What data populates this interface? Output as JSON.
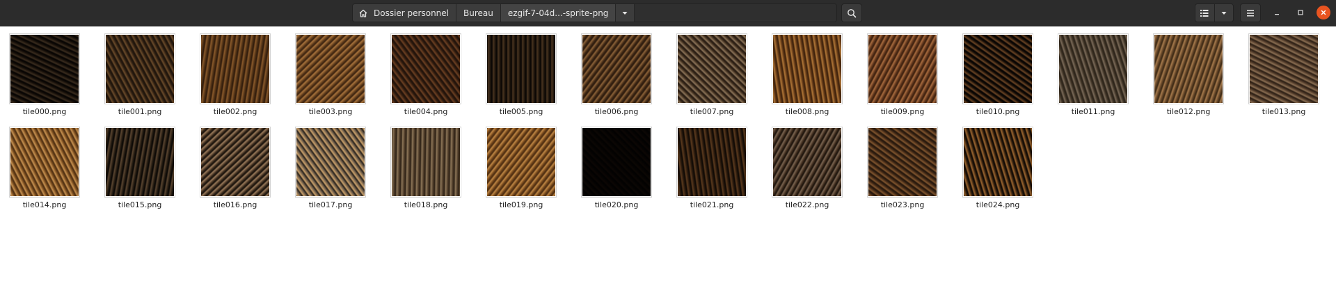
{
  "header": {
    "breadcrumbs": [
      {
        "label": "Dossier personnel",
        "icon": "home-icon"
      },
      {
        "label": "Bureau"
      },
      {
        "label": "ezgif-7-04d...-sprite-png"
      }
    ],
    "search_icon": "search-icon",
    "view_icon": "list-view-icon",
    "view_options_icon": "chevron-down-icon",
    "menu_icon": "hamburger-menu-icon",
    "window_controls": [
      "minimize-icon",
      "maximize-icon",
      "close-icon"
    ],
    "accent_close": "#e95420"
  },
  "files": [
    {
      "name": "tile000.png",
      "colors": [
        "#050302",
        "#3a2c1e",
        "#120c07"
      ]
    },
    {
      "name": "tile001.png",
      "colors": [
        "#1c130b",
        "#6b4b2a",
        "#2a1c10"
      ]
    },
    {
      "name": "tile002.png",
      "colors": [
        "#2e1a0b",
        "#8a5a2b",
        "#4b2e14"
      ]
    },
    {
      "name": "tile003.png",
      "colors": [
        "#3a220f",
        "#a8733c",
        "#5d3a1a"
      ]
    },
    {
      "name": "tile004.png",
      "colors": [
        "#1e110a",
        "#6d4022",
        "#2d1a0e"
      ]
    },
    {
      "name": "tile005.png",
      "colors": [
        "#060403",
        "#4a3520",
        "#1c130b"
      ]
    },
    {
      "name": "tile006.png",
      "colors": [
        "#2b1a0d",
        "#8c6238",
        "#3e2714"
      ]
    },
    {
      "name": "tile007.png",
      "colors": [
        "#231810",
        "#8b7358",
        "#3d2c1c"
      ]
    },
    {
      "name": "tile008.png",
      "colors": [
        "#3a1f0a",
        "#b07637",
        "#5a3314"
      ]
    },
    {
      "name": "tile009.png",
      "colors": [
        "#3b1f0d",
        "#a86b3e",
        "#5a321a"
      ]
    },
    {
      "name": "tile010.png",
      "colors": [
        "#030202",
        "#6a4424",
        "#140c06"
      ]
    },
    {
      "name": "tile011.png",
      "colors": [
        "#2a2218",
        "#7a6a58",
        "#3a2f22"
      ]
    },
    {
      "name": "tile012.png",
      "colors": [
        "#3b2814",
        "#a67a4c",
        "#5d4024"
      ]
    },
    {
      "name": "tile013.png",
      "colors": [
        "#2b1e14",
        "#8a6e52",
        "#4a3525"
      ]
    },
    {
      "name": "tile014.png",
      "colors": [
        "#4a2c10",
        "#c79150",
        "#74481c"
      ]
    },
    {
      "name": "tile015.png",
      "colors": [
        "#080604",
        "#5a4530",
        "#20180f"
      ]
    },
    {
      "name": "tile016.png",
      "colors": [
        "#16100a",
        "#9a7a5a",
        "#3a2a1c"
      ]
    },
    {
      "name": "tile017.png",
      "colors": [
        "#26201a",
        "#c9a06a",
        "#6b5a48"
      ]
    },
    {
      "name": "tile018.png",
      "colors": [
        "#2e2216",
        "#8d7658",
        "#4a3826"
      ]
    },
    {
      "name": "tile019.png",
      "colors": [
        "#4a2b10",
        "#c08744",
        "#6d4219"
      ]
    },
    {
      "name": "tile020.png",
      "colors": [
        "#020101",
        "#0c0704",
        "#050302"
      ]
    },
    {
      "name": "tile021.png",
      "colors": [
        "#0d0804",
        "#5b3a1e",
        "#24160b"
      ]
    },
    {
      "name": "tile022.png",
      "colors": [
        "#1a120b",
        "#7a6450",
        "#3a281a"
      ]
    },
    {
      "name": "tile023.png",
      "colors": [
        "#22150b",
        "#80552e",
        "#3a2413"
      ]
    },
    {
      "name": "tile024.png",
      "colors": [
        "#0a0603",
        "#9c6630",
        "#2e1c0c"
      ]
    }
  ]
}
